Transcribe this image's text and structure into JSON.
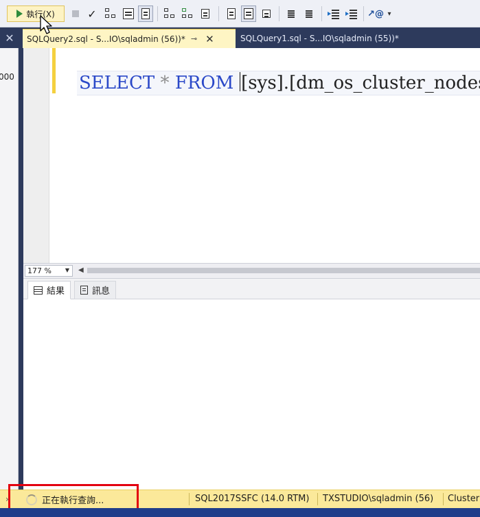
{
  "toolbar": {
    "execute_label": "執行(X)"
  },
  "tabs": {
    "active_label": "SQLQuery2.sql - S...IO\\sqladmin (56))*",
    "inactive_label": "SQLQuery1.sql - S...IO\\sqladmin (55))*"
  },
  "left_panel": {
    "fragment": "000"
  },
  "editor": {
    "kw_select": "SELECT",
    "star": "*",
    "kw_from": "FROM",
    "object": "[sys].[dm_os_cluster_nodes]"
  },
  "zoom": {
    "level": "177 %"
  },
  "results": {
    "tab_results": "結果",
    "tab_messages": "訊息"
  },
  "status": {
    "executing": "正在執行查詢...",
    "server": "SQL2017SSFC (14.0 RTM)",
    "login": "TXSTUDIO\\sqladmin (56)",
    "database": "Cluster"
  },
  "colors": {
    "keyword": "#2a48c8",
    "status_bar": "#fbe99a",
    "highlight": "#e3000f",
    "tab_strip": "#2d3a5c"
  },
  "icons": [
    "play-icon",
    "stop-icon",
    "parse-check-icon",
    "query-plan-icon",
    "results-to-text-icon",
    "results-to-grid-icon",
    "results-to-file-icon",
    "comment-icon",
    "uncomment-icon",
    "decrease-indent-icon",
    "increase-indent-icon",
    "specify-template-icon",
    "mouse-cursor-icon"
  ]
}
